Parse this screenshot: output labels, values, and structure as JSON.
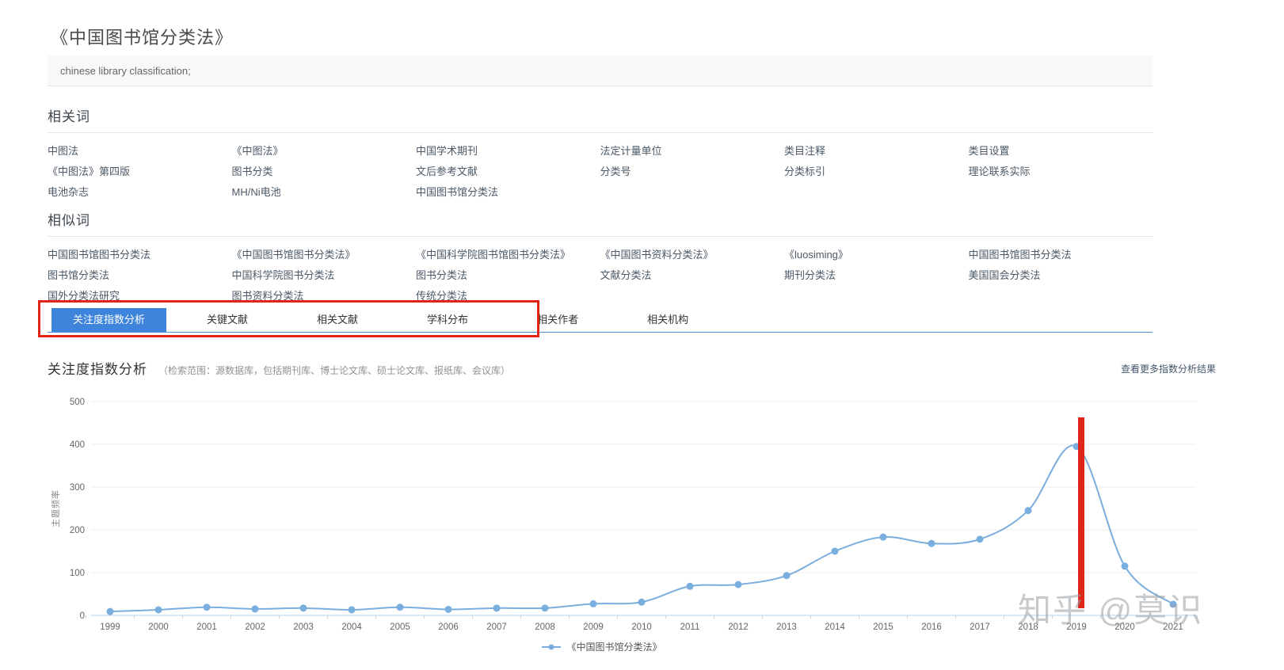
{
  "page": {
    "title": "《中国图书馆分类法》",
    "search_query": "chinese library classification;"
  },
  "related_words": {
    "heading": "相关词",
    "items": [
      "中图法",
      "《中图法》",
      "中国学术期刊",
      "法定计量单位",
      "类目注释",
      "类目设置",
      "《中图法》第四版",
      "图书分类",
      "文后参考文献",
      "分类号",
      "分类标引",
      "理论联系实际",
      "电池杂志",
      "MH/Ni电池",
      "中国图书馆分类法"
    ]
  },
  "similar_words": {
    "heading": "相似词",
    "items": [
      "中国图书馆图书分类法",
      "《中国图书馆图书分类法》",
      "《中国科学院图书馆图书分类法》",
      "《中国图书资料分类法》",
      "《luosiming》",
      "中国图书馆图书分类法",
      "图书馆分类法",
      "中国科学院图书分类法",
      "图书分类法",
      "文献分类法",
      "期刊分类法",
      "美国国会分类法",
      "国外分类法研究",
      "图书资料分类法",
      "传统分类法"
    ]
  },
  "tabs": [
    {
      "label": "关注度指数分析",
      "active": true
    },
    {
      "label": "关键文献",
      "active": false
    },
    {
      "label": "相关文献",
      "active": false
    },
    {
      "label": "学科分布",
      "active": false
    },
    {
      "label": "相关作者",
      "active": false
    },
    {
      "label": "相关机构",
      "active": false
    }
  ],
  "index_section": {
    "heading": "关注度指数分析",
    "scope_note": "（检索范围：源数据库，包括期刊库、博士论文库、硕士论文库、报纸库、会议库）",
    "more_link": "查看更多指数分析结果"
  },
  "chart_data": {
    "type": "line",
    "smooth": true,
    "ylabel": "主题频率",
    "ylim": [
      0,
      500
    ],
    "yticks": [
      0,
      100,
      200,
      300,
      400,
      500
    ],
    "grid": true,
    "legend_position": "bottom",
    "categories": [
      "1999",
      "2000",
      "2001",
      "2002",
      "2003",
      "2004",
      "2005",
      "2006",
      "2007",
      "2008",
      "2009",
      "2010",
      "2011",
      "2012",
      "2013",
      "2014",
      "2015",
      "2016",
      "2017",
      "2018",
      "2019",
      "2020",
      "2021"
    ],
    "series": [
      {
        "name": "《中国图书馆分类法》",
        "values": [
          9,
          13,
          19,
          15,
          17,
          13,
          19,
          14,
          17,
          17,
          27,
          31,
          68,
          72,
          93,
          150,
          183,
          168,
          178,
          245,
          395,
          115,
          26
        ]
      }
    ],
    "annotation": {
      "type": "vertical_line",
      "x": "2019",
      "color": "#e02417"
    }
  },
  "watermark": "知乎 @莫识",
  "colors": {
    "accent_blue": "#3e84db",
    "line_blue": "#79aede",
    "axis_line": "#b6d0ea",
    "grid_line": "#ececec",
    "annotation_red": "#e02417",
    "link_gray": "#4b5966",
    "watermark_gray": "#9aa0a4"
  }
}
